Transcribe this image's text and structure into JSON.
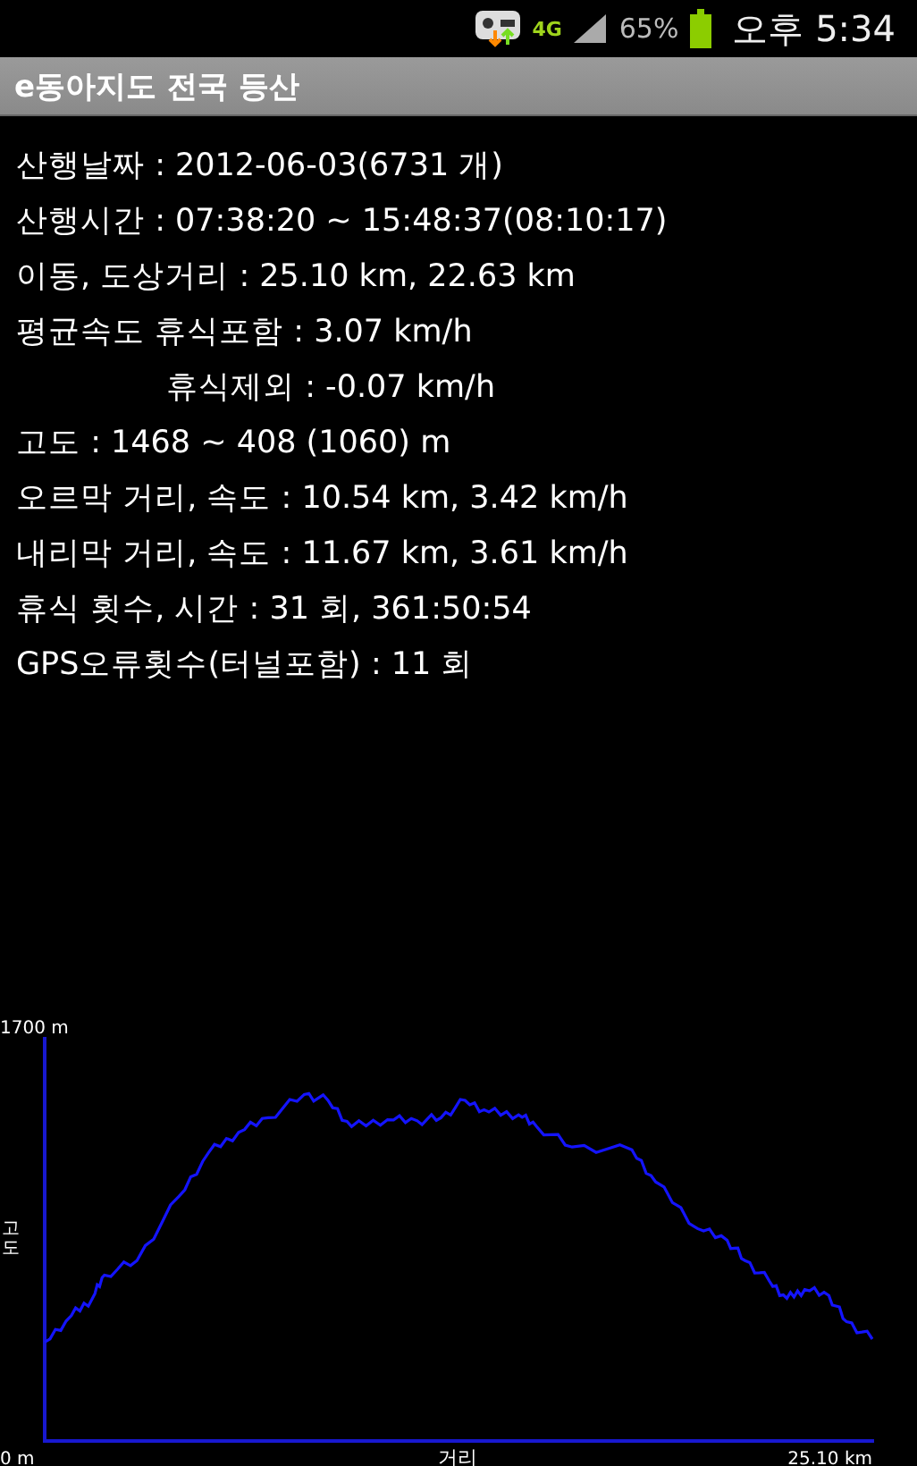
{
  "status_bar": {
    "network": "4G",
    "battery": "65%",
    "time": "오후 5:34"
  },
  "title_bar": {
    "title": "e동아지도 전국 등산"
  },
  "stats": [
    {
      "kind": "plain",
      "text": "산행날짜 : 2012-06-03(6731 개)"
    },
    {
      "kind": "plain",
      "text": "산행시간 : 07:38:20 ~ 15:48:37(08:10:17)"
    },
    {
      "kind": "plain",
      "text": "이동, 도상거리 :  25.10 km,  22.63 km"
    },
    {
      "kind": "plain",
      "text": "평균속도 휴식포함 :  3.07 km/h"
    },
    {
      "kind": "sub",
      "text": "휴식제외 : -0.07 km/h"
    },
    {
      "kind": "plain",
      "text": "고도 : 1468 ~ 408 (1060) m"
    },
    {
      "kind": "plain",
      "text": "오르막 거리, 속도 : 10.54 km,  3.42 km/h"
    },
    {
      "kind": "plain",
      "text": "내리막 거리, 속도 : 11.67 km,  3.61 km/h"
    },
    {
      "kind": "plain",
      "text": "휴식 횟수, 시간 : 31 회, 361:50:54"
    },
    {
      "kind": "plain",
      "text": "GPS오류횟수(터널포함) : 11 회"
    }
  ],
  "elevation_graph": {
    "y_max_label": "1700 m",
    "y_min_label": "0 m",
    "y_title": "고도",
    "x_title": "거리",
    "x_end_label": "25.10 km"
  }
}
